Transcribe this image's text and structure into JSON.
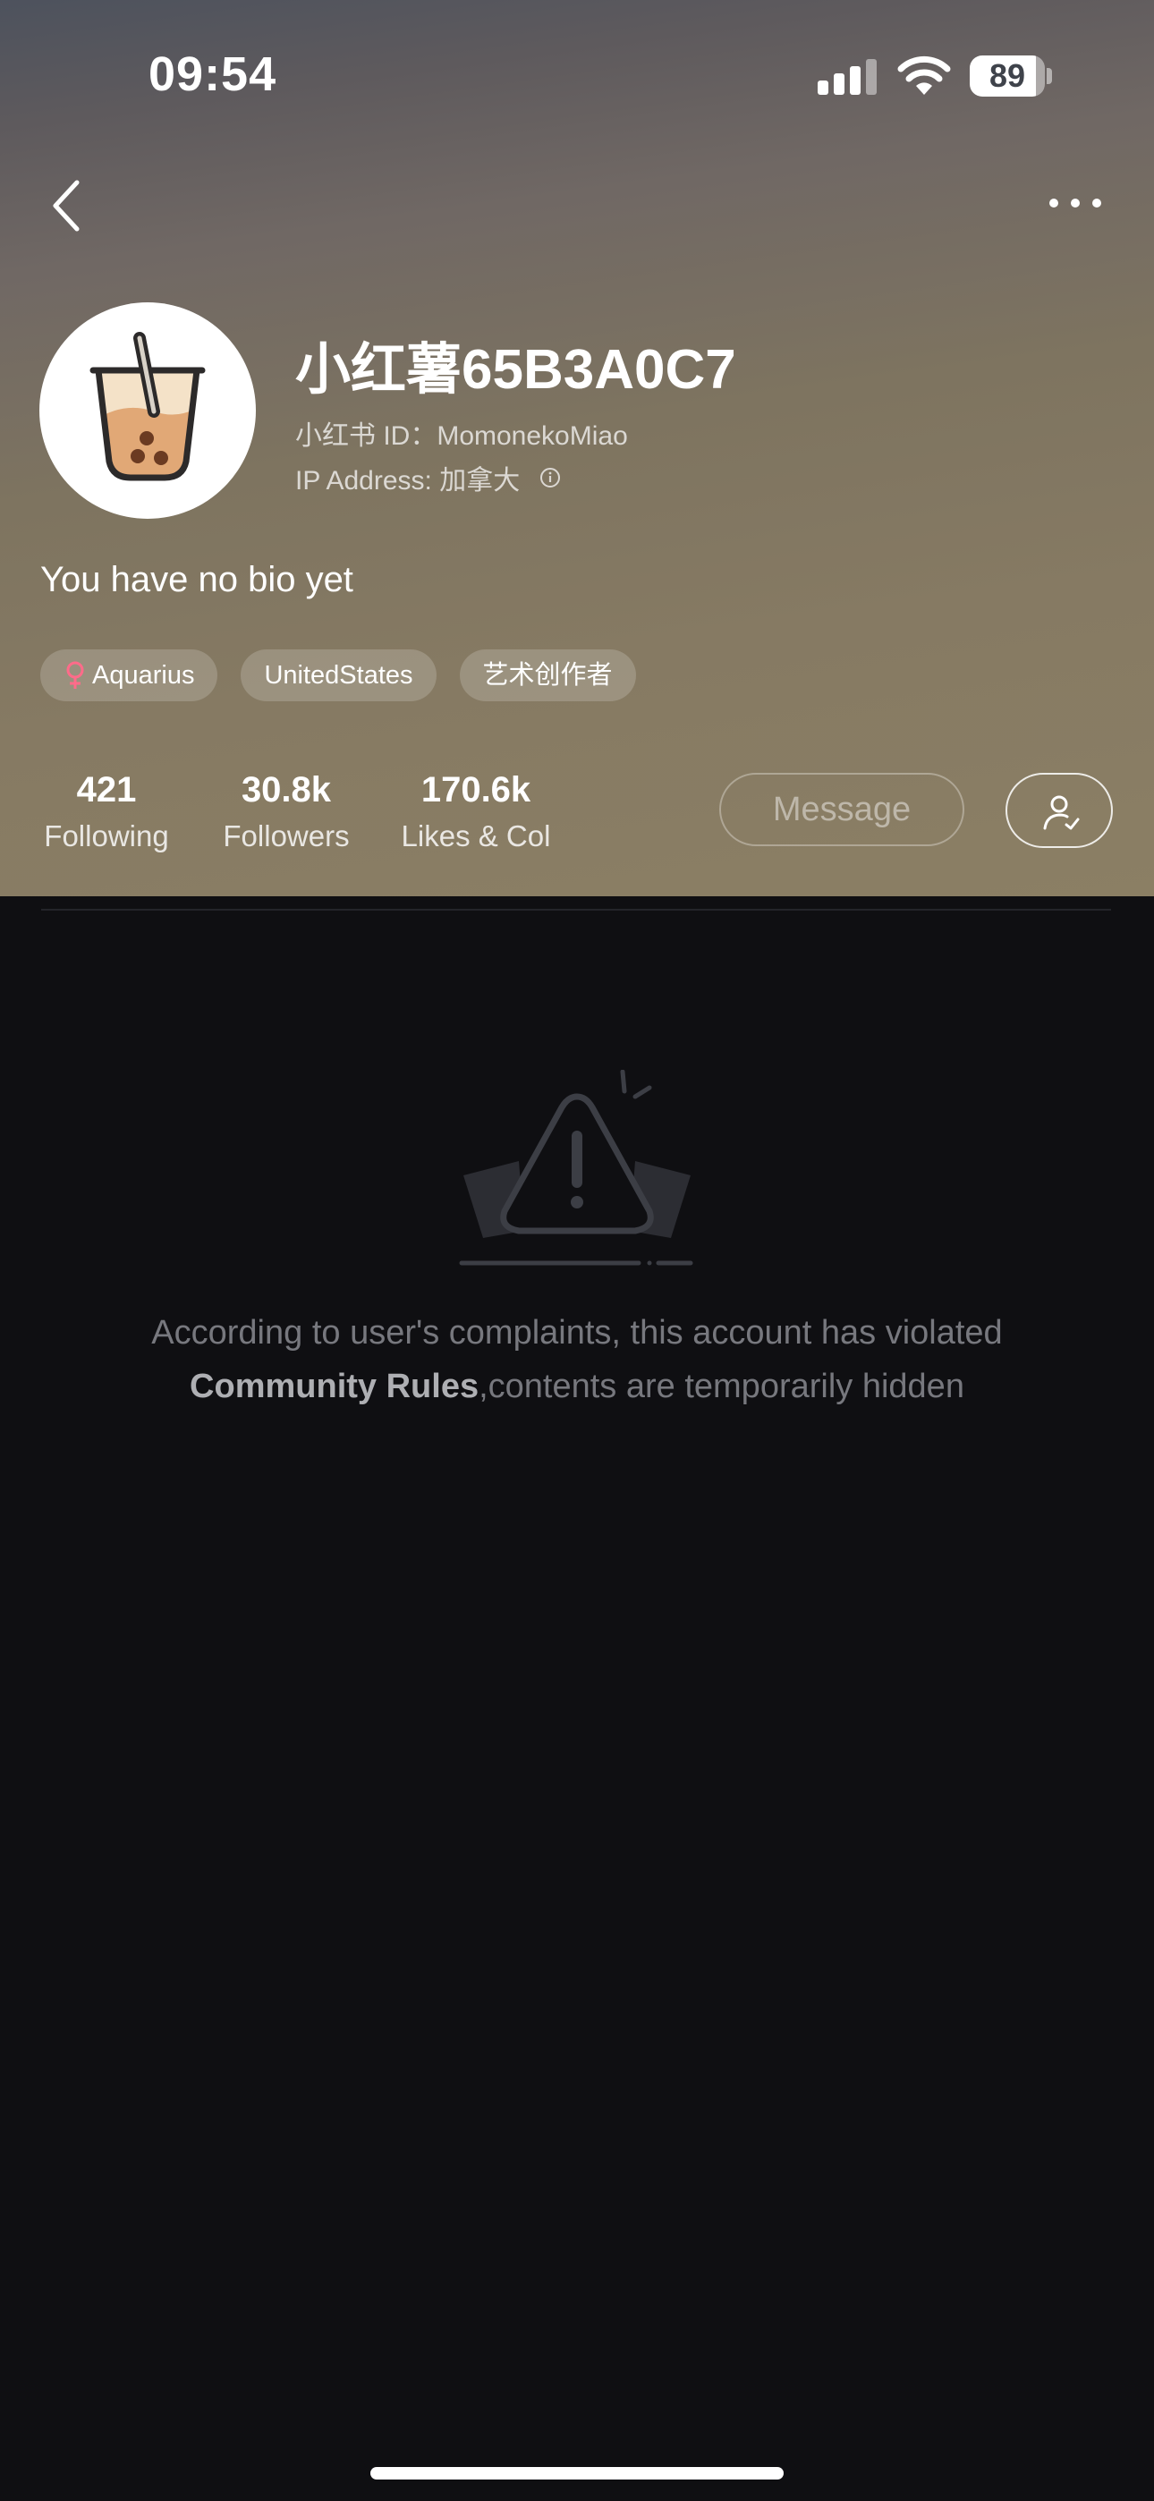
{
  "status_bar": {
    "time": "09:54",
    "battery": "89",
    "icons": [
      "signal-icon",
      "wifi-icon",
      "battery-icon"
    ]
  },
  "nav": {
    "back_icon": "chevron-left-icon",
    "more_icon": "more-dots-icon"
  },
  "profile": {
    "avatar_icon": "bubble-tea-icon",
    "nickname": "小红薯65B3A0C7",
    "user_id": "小红书 ID：MomonekoMiao",
    "ip_address": "IP Address: 加拿大",
    "bio": "You have no bio yet",
    "tags": [
      {
        "label": "Aquarius",
        "icon": "female-icon",
        "icon_color": "#ff6b8a"
      },
      {
        "label": "UnitedStates"
      },
      {
        "label": "艺术创作者"
      }
    ]
  },
  "stats": [
    {
      "value": "421",
      "label": "Following"
    },
    {
      "value": "30.8k",
      "label": "Followers"
    },
    {
      "value": "170.6k",
      "label": "Likes & Col"
    }
  ],
  "actions": {
    "message_label": "Message",
    "follow_icon": "user-check-icon"
  },
  "notice": {
    "icon": "warning-icon",
    "line1": "According to user's complaints, this account has violated",
    "rules_link": "Community Rules",
    "line2": ",contents are temporarily hidden"
  },
  "colors": {
    "header_gradient_top": "#4d525d",
    "header_gradient_bottom": "#8b7f64",
    "page_background": "#0f0f12",
    "notice_text": "#77787e"
  }
}
